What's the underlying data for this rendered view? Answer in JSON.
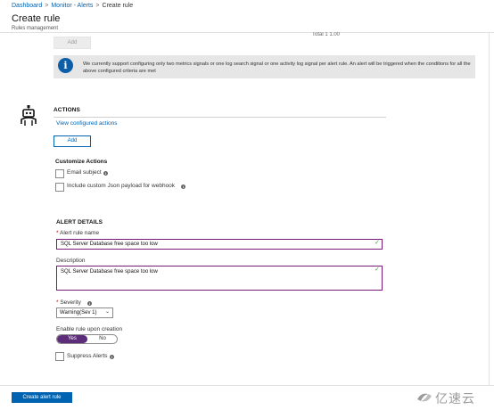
{
  "breadcrumb": {
    "items": [
      "Dashboard",
      "Monitor - Alerts",
      "Create rule"
    ],
    "separator": ">"
  },
  "header": {
    "title": "Create rule",
    "subtitle": "Rules management"
  },
  "condition": {
    "cut_text": "Total 1 1.00",
    "add_label": "Add",
    "info_text": "We currently support configuring only two metrics signals or one log search signal or one activity log signal per alert rule. An alert will be triggered when the conditions for all the above configured criteria are met"
  },
  "actions": {
    "heading": "ACTIONS",
    "view_link": "View configured actions",
    "add_label": "Add",
    "customize_heading": "Customize Actions",
    "email_subject_label": "Email subject",
    "custom_json_label": "Include custom Json payload for webhook"
  },
  "alert_details": {
    "heading": "ALERT DETAILS",
    "rule_name_label": "Alert rule name",
    "rule_name_value": "SQL Server Database free space too low",
    "description_label": "Description",
    "description_value": "SQL Server Database free space too low",
    "severity_label": "Severity",
    "severity_value": "Warning(Sev 1)",
    "enable_label": "Enable rule upon creation",
    "enable_yes": "Yes",
    "enable_no": "No",
    "suppress_label": "Suppress Alerts"
  },
  "footer": {
    "create_label": "Create alert rule"
  },
  "watermark": {
    "text": "亿速云"
  },
  "colors": {
    "accent": "#0063b1",
    "toggle_on": "#5d2d7a",
    "field_border": "#7a1a78",
    "valid_check": "#35a835"
  }
}
